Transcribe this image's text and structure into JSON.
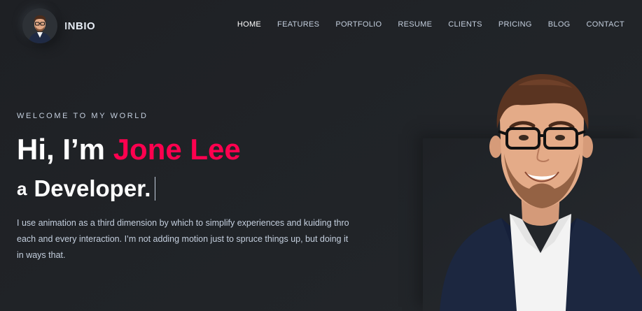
{
  "brand": {
    "name": "INBIO"
  },
  "nav": {
    "items": [
      {
        "label": "HOME",
        "active": true
      },
      {
        "label": "FEATURES",
        "active": false
      },
      {
        "label": "PORTFOLIO",
        "active": false
      },
      {
        "label": "RESUME",
        "active": false
      },
      {
        "label": "CLIENTS",
        "active": false
      },
      {
        "label": "PRICING",
        "active": false
      },
      {
        "label": "BLOG",
        "active": false
      },
      {
        "label": "CONTACT",
        "active": false
      }
    ]
  },
  "hero": {
    "kicker": "WELCOME TO MY WORLD",
    "greeting": "Hi, I’m ",
    "name": "Jone Lee",
    "role_prefix": "a",
    "role": "Developer.",
    "description": "I use animation as a third dimension by which to simplify experiences and kuiding thro each and every interaction. I’m not adding motion just to spruce things up, but doing it in ways that."
  },
  "colors": {
    "background": "#212428",
    "accent": "#ff014f",
    "text": "#c4cfde",
    "heading": "#ffffff"
  },
  "icons": {
    "avatar": "person-portrait",
    "hero": "person-portrait"
  }
}
